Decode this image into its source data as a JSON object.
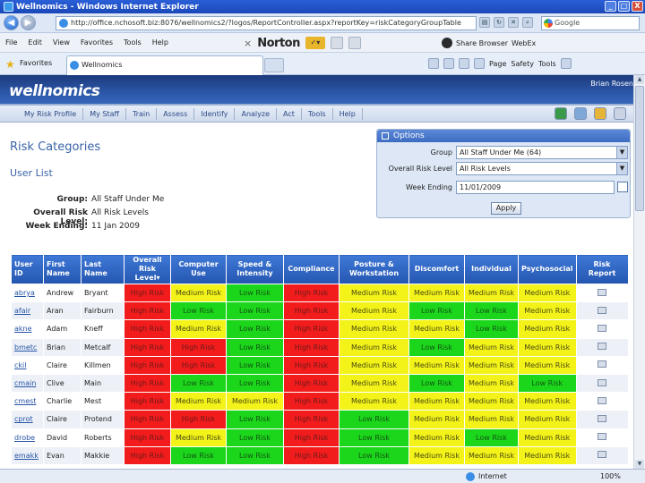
{
  "window": {
    "title": "Wellnomics - Windows Internet Explorer",
    "min": "_",
    "max": "□",
    "close": "X"
  },
  "address": {
    "url": "http://office.nchosoft.biz:8076/wellnomics2/?logos/ReportController.aspx?reportKey=riskCategoryGroupTable",
    "search_placeholder": "Google"
  },
  "menu": {
    "items": [
      "File",
      "Edit",
      "View",
      "Favorites",
      "Tools",
      "Help"
    ],
    "norton": "Norton",
    "share_label": "Share Browser",
    "webex_label": "WebEx"
  },
  "favbar": {
    "favorites_label": "Favorites",
    "tab_title": "Wellnomics",
    "cmd_items": [
      "Page",
      "Safety",
      "Tools"
    ]
  },
  "header": {
    "logo": "wellnomics",
    "user": "Brian Rosen"
  },
  "nav": {
    "items": [
      "My Risk Profile",
      "My Staff",
      "Train",
      "Assess",
      "Identify",
      "Analyze",
      "Act",
      "Tools",
      "Help"
    ]
  },
  "page": {
    "title": "Risk Categories",
    "subtitle": "User List"
  },
  "summary": {
    "group_label": "Group:",
    "group_value": "All Staff Under Me",
    "risk_label": "Overall Risk Level:",
    "risk_value": "All Risk Levels",
    "week_label": "Week Ending:",
    "week_value": "11 Jan 2009"
  },
  "options": {
    "title": "Options",
    "group_label": "Group",
    "group_value": "All Staff Under Me (64)",
    "risk_label": "Overall Risk Level",
    "risk_value": "All Risk Levels",
    "week_label": "Week Ending",
    "week_value": "11/01/2009",
    "apply": "Apply"
  },
  "table": {
    "headers": [
      "User ID",
      "First Name",
      "Last Name",
      "Overall Risk Level▾",
      "Computer Use",
      "Speed & Intensity",
      "Compliance",
      "Posture & Workstation",
      "Discomfort",
      "Individual",
      "Psychosocial",
      "Risk Report"
    ],
    "rows": [
      {
        "uid": "abrya",
        "first": "Andrew",
        "last": "Bryant",
        "risks": [
          "High Risk",
          "Medium Risk",
          "Low Risk",
          "High Risk",
          "Medium Risk",
          "Medium Risk",
          "Medium Risk",
          "Medium Risk"
        ]
      },
      {
        "uid": "afair",
        "first": "Aran",
        "last": "Fairburn",
        "risks": [
          "High Risk",
          "Low Risk",
          "Low Risk",
          "High Risk",
          "Medium Risk",
          "Low Risk",
          "Low Risk",
          "Medium Risk"
        ]
      },
      {
        "uid": "akne",
        "first": "Adam",
        "last": "Kneff",
        "risks": [
          "High Risk",
          "Medium Risk",
          "Low Risk",
          "High Risk",
          "Medium Risk",
          "Medium Risk",
          "Low Risk",
          "Medium Risk"
        ]
      },
      {
        "uid": "bmetc",
        "first": "Brian",
        "last": "Metcalf",
        "risks": [
          "High Risk",
          "High Risk",
          "Low Risk",
          "High Risk",
          "Medium Risk",
          "Low Risk",
          "Medium Risk",
          "Medium Risk"
        ]
      },
      {
        "uid": "ckil",
        "first": "Claire",
        "last": "Killmen",
        "risks": [
          "High Risk",
          "High Risk",
          "Low Risk",
          "High Risk",
          "Medium Risk",
          "Medium Risk",
          "Medium Risk",
          "Medium Risk"
        ]
      },
      {
        "uid": "cmain",
        "first": "Clive",
        "last": "Main",
        "risks": [
          "High Risk",
          "Low Risk",
          "Low Risk",
          "High Risk",
          "Medium Risk",
          "Low Risk",
          "Medium Risk",
          "Low Risk"
        ]
      },
      {
        "uid": "cmest",
        "first": "Charlie",
        "last": "Mest",
        "risks": [
          "High Risk",
          "Medium Risk",
          "Medium Risk",
          "High Risk",
          "Medium Risk",
          "Medium Risk",
          "Medium Risk",
          "Medium Risk"
        ]
      },
      {
        "uid": "cprot",
        "first": "Claire",
        "last": "Protend",
        "risks": [
          "High Risk",
          "High Risk",
          "Low Risk",
          "High Risk",
          "Low Risk",
          "Medium Risk",
          "Medium Risk",
          "Medium Risk"
        ]
      },
      {
        "uid": "drobe",
        "first": "David",
        "last": "Roberts",
        "risks": [
          "High Risk",
          "Medium Risk",
          "Low Risk",
          "High Risk",
          "Low Risk",
          "Medium Risk",
          "Low Risk",
          "Medium Risk"
        ]
      },
      {
        "uid": "emakk",
        "first": "Evan",
        "last": "Makkie",
        "risks": [
          "High Risk",
          "Low Risk",
          "Low Risk",
          "High Risk",
          "Low Risk",
          "Medium Risk",
          "Medium Risk",
          "Medium Risk"
        ]
      }
    ]
  },
  "status": {
    "zone": "Internet",
    "zoom": "100%"
  },
  "colors": {
    "high": "#f21c1c",
    "medium": "#f3f31a",
    "low": "#1bd61b",
    "header_blue": "#2456b0"
  }
}
